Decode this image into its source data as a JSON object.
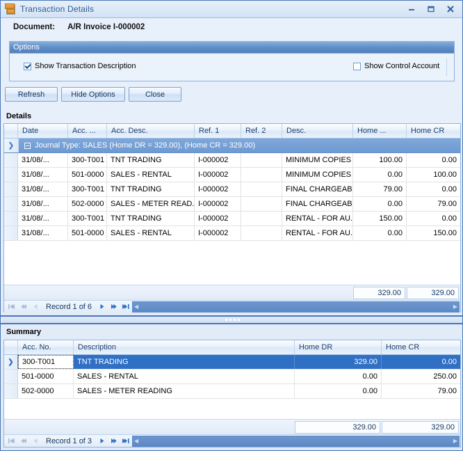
{
  "window": {
    "title": "Transaction Details",
    "icon": "document-icon",
    "buttons": {
      "minimize": "minimize-icon",
      "maximize": "maximize-icon",
      "close": "close-icon"
    }
  },
  "document": {
    "label": "Document:",
    "value": "A/R Invoice I-000002"
  },
  "options": {
    "caption": "Options",
    "show_transaction_description": {
      "label": "Show Transaction Description",
      "checked": true
    },
    "show_control_account": {
      "label": "Show Control Account",
      "checked": false
    }
  },
  "toolbar": {
    "refresh_label": "Refresh",
    "hide_options_label": "Hide Options",
    "close_label": "Close"
  },
  "details": {
    "section_label": "Details",
    "columns": [
      "Date",
      "Acc. ...",
      "Acc. Desc.",
      "Ref. 1",
      "Ref. 2",
      "Desc.",
      "Home ...",
      "Home CR"
    ],
    "group_row": "Journal Type: SALES (Home DR = 329.00), (Home CR = 329.00)",
    "rows": [
      {
        "date": "31/08/...",
        "acc_no": "300-T001",
        "acc_desc": "TNT TRADING",
        "ref1": "I-000002",
        "ref2": "",
        "desc": "MINIMUM COPIES",
        "home_dr": "100.00",
        "home_cr": "0.00"
      },
      {
        "date": "31/08/...",
        "acc_no": "501-0000",
        "acc_desc": "SALES - RENTAL",
        "ref1": "I-000002",
        "ref2": "",
        "desc": "MINIMUM COPIES",
        "home_dr": "0.00",
        "home_cr": "100.00"
      },
      {
        "date": "31/08/...",
        "acc_no": "300-T001",
        "acc_desc": "TNT TRADING",
        "ref1": "I-000002",
        "ref2": "",
        "desc": "FINAL CHARGEAB...",
        "home_dr": "79.00",
        "home_cr": "0.00"
      },
      {
        "date": "31/08/...",
        "acc_no": "502-0000",
        "acc_desc": "SALES - METER READ...",
        "ref1": "I-000002",
        "ref2": "",
        "desc": "FINAL CHARGEAB...",
        "home_dr": "0.00",
        "home_cr": "79.00"
      },
      {
        "date": "31/08/...",
        "acc_no": "300-T001",
        "acc_desc": "TNT TRADING",
        "ref1": "I-000002",
        "ref2": "",
        "desc": "RENTAL - FOR AU...",
        "home_dr": "150.00",
        "home_cr": "0.00"
      },
      {
        "date": "31/08/...",
        "acc_no": "501-0000",
        "acc_desc": "SALES - RENTAL",
        "ref1": "I-000002",
        "ref2": "",
        "desc": "RENTAL - FOR AU...",
        "home_dr": "0.00",
        "home_cr": "150.00"
      }
    ],
    "totals": {
      "home_dr": "329.00",
      "home_cr": "329.00"
    },
    "navigator": {
      "record_text": "Record 1 of 6"
    }
  },
  "summary": {
    "section_label": "Summary",
    "columns": [
      "Acc. No.",
      "Description",
      "Home DR",
      "Home CR"
    ],
    "rows": [
      {
        "acc_no": "300-T001",
        "description": "TNT TRADING",
        "home_dr": "329.00",
        "home_cr": "0.00",
        "selected": true
      },
      {
        "acc_no": "501-0000",
        "description": "SALES - RENTAL",
        "home_dr": "0.00",
        "home_cr": "250.00",
        "selected": false
      },
      {
        "acc_no": "502-0000",
        "description": "SALES - METER READING",
        "home_dr": "0.00",
        "home_cr": "79.00",
        "selected": false
      }
    ],
    "totals": {
      "home_dr": "329.00",
      "home_cr": "329.00"
    },
    "navigator": {
      "record_text": "Record 1 of 3"
    }
  },
  "colors": {
    "accent": "#2f6fc4",
    "frame": "#4a76b8",
    "caption_bar": "#5e8cc6",
    "background": "#dfeaf8"
  }
}
